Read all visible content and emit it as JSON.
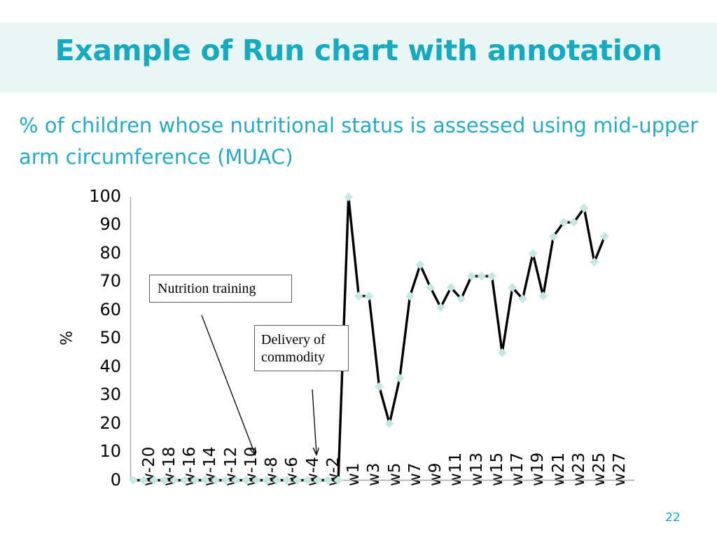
{
  "slide": {
    "title": "Example of Run chart with annotation",
    "subtitle": "% of children whose nutritional status is assessed using mid-upper arm circumference (MUAC)",
    "page_number": "22",
    "title_color": "#17a9bd",
    "subtitle_color": "#28a9c4",
    "title_band_color": "#e9f6f6"
  },
  "annotations": [
    {
      "id": "nutrition-training",
      "text": "Nutrition training"
    },
    {
      "id": "delivery-of-commodity",
      "line1": "Delivery of",
      "line2": "commodity"
    }
  ],
  "chart_data": {
    "type": "line",
    "title": "% of children whose nutritional status is assessed using mid-upper arm circumference (MUAC)",
    "xlabel": "",
    "ylabel": "%",
    "ylim": [
      0,
      100
    ],
    "ytick_step": 10,
    "yticks": [
      "100",
      "90",
      "80",
      "70",
      "60",
      "50",
      "40",
      "30",
      "20",
      "10",
      "0"
    ],
    "grid": false,
    "legend": "none",
    "marker": "diamond",
    "marker_color": "#c5e8e4",
    "line_color": "#000000",
    "x": [
      "w-20",
      "w-19",
      "w-18",
      "w-17",
      "w-16",
      "w-15",
      "w-14",
      "w-13",
      "w-12",
      "w-11",
      "w-10",
      "w-9",
      "w-8",
      "w-7",
      "w-6",
      "w-5",
      "w-4",
      "w-3",
      "w-2",
      "w-1",
      "w1",
      "w2",
      "w3",
      "w4",
      "w5",
      "w6",
      "w7",
      "w8",
      "w9",
      "w10",
      "w11",
      "w12",
      "w13",
      "w14",
      "w15",
      "w16",
      "w17",
      "w18",
      "w19",
      "w20",
      "w21",
      "w22",
      "w23",
      "w24",
      "w25",
      "w26",
      "w27"
    ],
    "xtick_labels_shown": [
      "w-20",
      "w-18",
      "w-16",
      "w-14",
      "w-12",
      "w-10",
      "w-8",
      "w-6",
      "w-4",
      "w-2",
      "w1",
      "w3",
      "w5",
      "w7",
      "w9",
      "w11",
      "w13",
      "w15",
      "w17",
      "w19",
      "w21",
      "w23",
      "w25",
      "w27"
    ],
    "values": [
      0,
      0,
      0,
      0,
      0,
      0,
      0,
      0,
      0,
      0,
      0,
      0,
      0,
      0,
      0,
      0,
      0,
      0,
      0,
      0,
      0,
      100,
      65,
      65,
      33,
      20,
      36,
      65,
      76,
      68,
      61,
      68,
      64,
      72,
      72,
      72,
      45,
      68,
      64,
      80,
      65,
      86,
      91,
      91,
      96,
      77,
      86
    ]
  }
}
